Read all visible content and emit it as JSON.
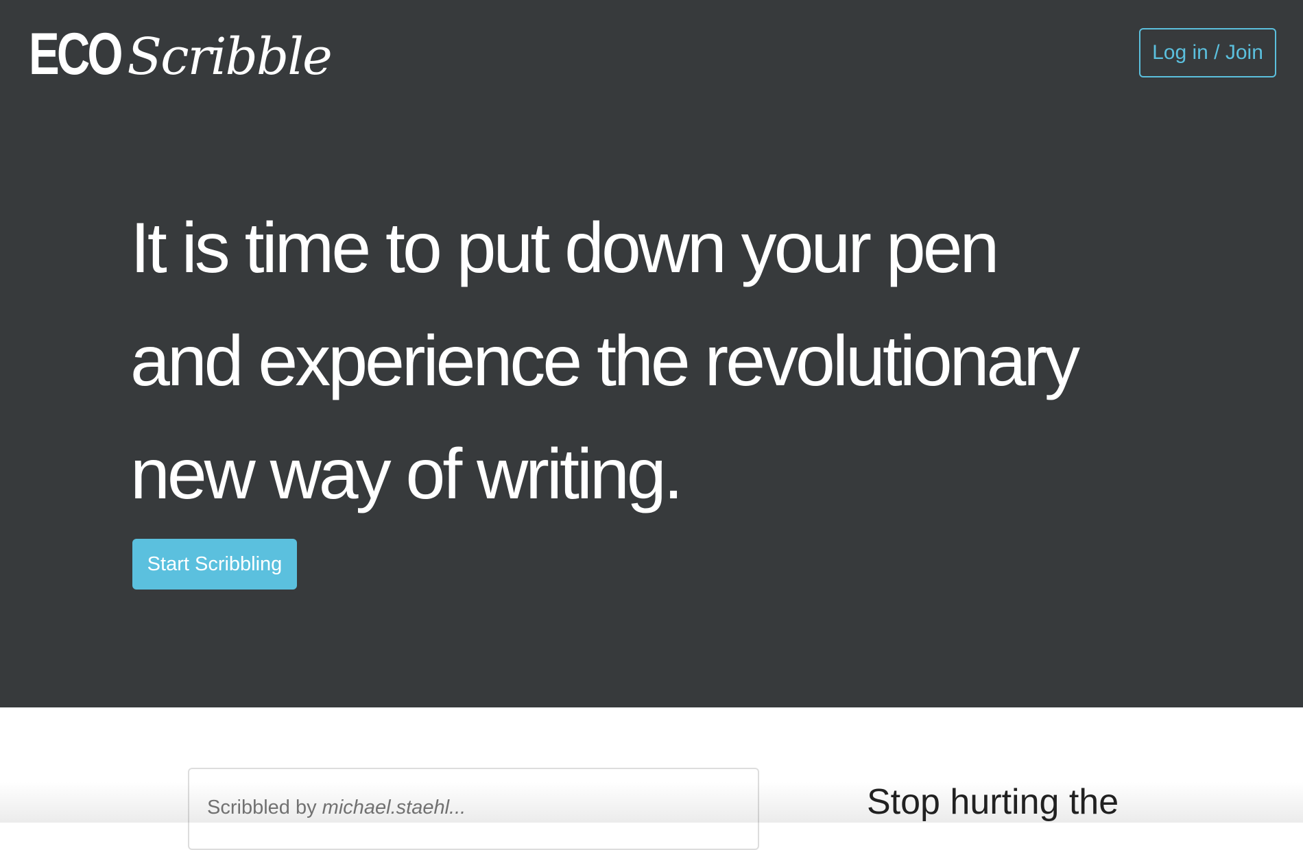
{
  "header": {
    "logo_bold": "ECO",
    "logo_script": "Scribble",
    "login_label": "Log in / Join"
  },
  "hero": {
    "headline_lines": [
      "It is time to put down your pen",
      "and experience the revolutionary",
      "new way of writing."
    ],
    "cta_label": "Start Scribbling"
  },
  "feed": {
    "card": {
      "prefix": "Scribbled by ",
      "author": "michael.staehl..."
    },
    "side_heading": "Stop hurting the"
  },
  "colors": {
    "hero_background": "#373a3c",
    "accent": "#5bc0de",
    "text_on_dark": "#ffffff"
  }
}
